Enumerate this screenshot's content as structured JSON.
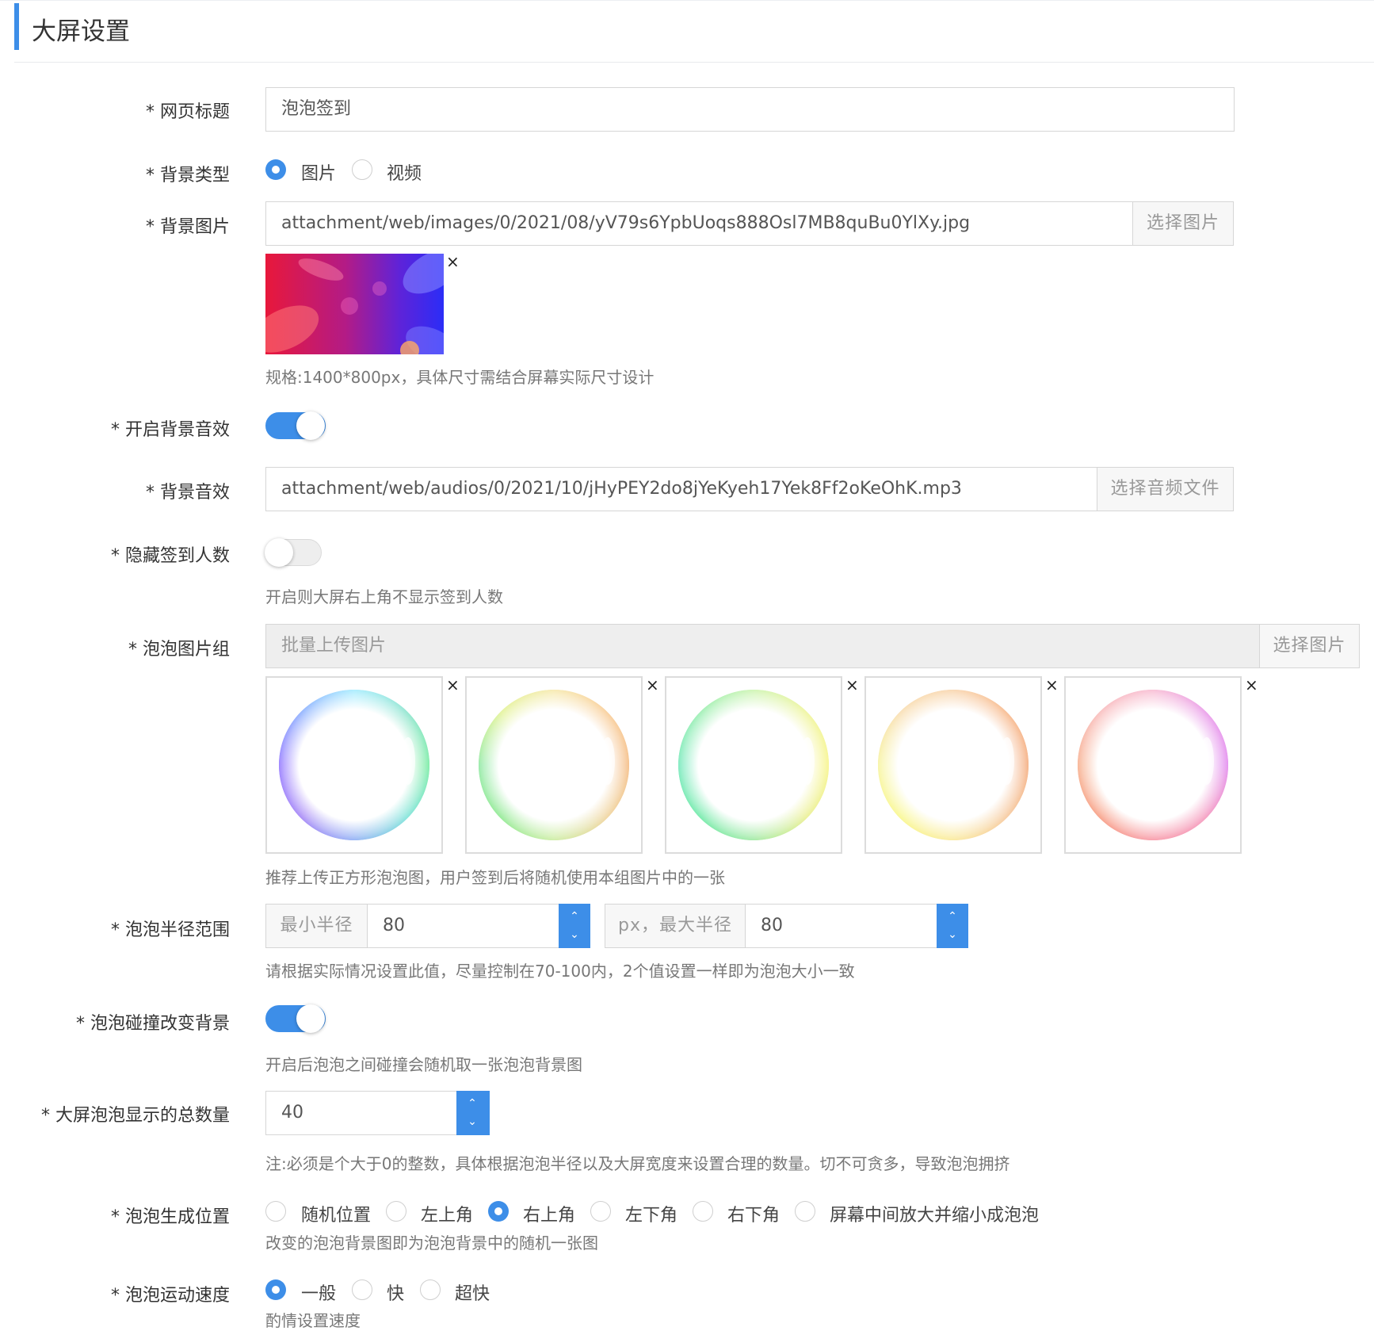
{
  "page": {
    "title": "大屏设置"
  },
  "fields": {
    "web_title": {
      "label": "* 网页标题",
      "value": "泡泡签到"
    },
    "bg_type": {
      "label": "* 背景类型",
      "options": [
        "图片",
        "视频"
      ],
      "selected": "图片"
    },
    "bg_image": {
      "label": "* 背景图片",
      "value": "attachment/web/images/0/2021/08/yV79s6YpbUoqs888Osl7MB8quBu0YlXy.jpg",
      "button": "选择图片",
      "remove": "×",
      "help": "规格:1400*800px，具体尺寸需结合屏幕实际尺寸设计"
    },
    "bg_audio_enable": {
      "label": "* 开启背景音效",
      "on": true
    },
    "bg_audio": {
      "label": "* 背景音效",
      "value": "attachment/web/audios/0/2021/10/jHyPEY2do8jYeKyeh17Yek8Ff2oKeOhK.mp3",
      "button": "选择音频文件"
    },
    "hide_count": {
      "label": "* 隐藏签到人数",
      "on": false,
      "help": "开启则大屏右上角不显示签到人数"
    },
    "bubble_images": {
      "label": "* 泡泡图片组",
      "placeholder": "批量上传图片",
      "button": "选择图片",
      "remove": "×",
      "images": [
        "bubble-blue-green",
        "bubble-green-orange",
        "bubble-green-yellow",
        "bubble-yellow-orange",
        "bubble-orange-pink"
      ],
      "help": "推荐上传正方形泡泡图，用户签到后将随机使用本组图片中的一张"
    },
    "radius": {
      "label": "* 泡泡半径范围",
      "min_label": "最小半径",
      "min_value": "80",
      "max_label": "px，最大半径",
      "max_value": "80",
      "help": "请根据实际情况设置此值，尽量控制在70-100内，2个值设置一样即为泡泡大小一致"
    },
    "collide_change_bg": {
      "label": "* 泡泡碰撞改变背景",
      "on": true,
      "help": "开启后泡泡之间碰撞会随机取一张泡泡背景图"
    },
    "total": {
      "label": "* 大屏泡泡显示的总数量",
      "value": "40",
      "help": "注:必须是个大于0的整数，具体根据泡泡半径以及大屏宽度来设置合理的数量。切不可贪多，导致泡泡拥挤"
    },
    "position": {
      "label": "* 泡泡生成位置",
      "options": [
        "随机位置",
        "左上角",
        "右上角",
        "左下角",
        "右下角",
        "屏幕中间放大并缩小成泡泡"
      ],
      "selected": "右上角",
      "help": "改变的泡泡背景图即为泡泡背景中的随机一张图"
    },
    "speed": {
      "label": "* 泡泡运动速度",
      "options": [
        "一般",
        "快",
        "超快"
      ],
      "selected": "一般",
      "help": "酌情设置速度"
    }
  },
  "colors": {
    "accent": "#3d8ee8"
  }
}
